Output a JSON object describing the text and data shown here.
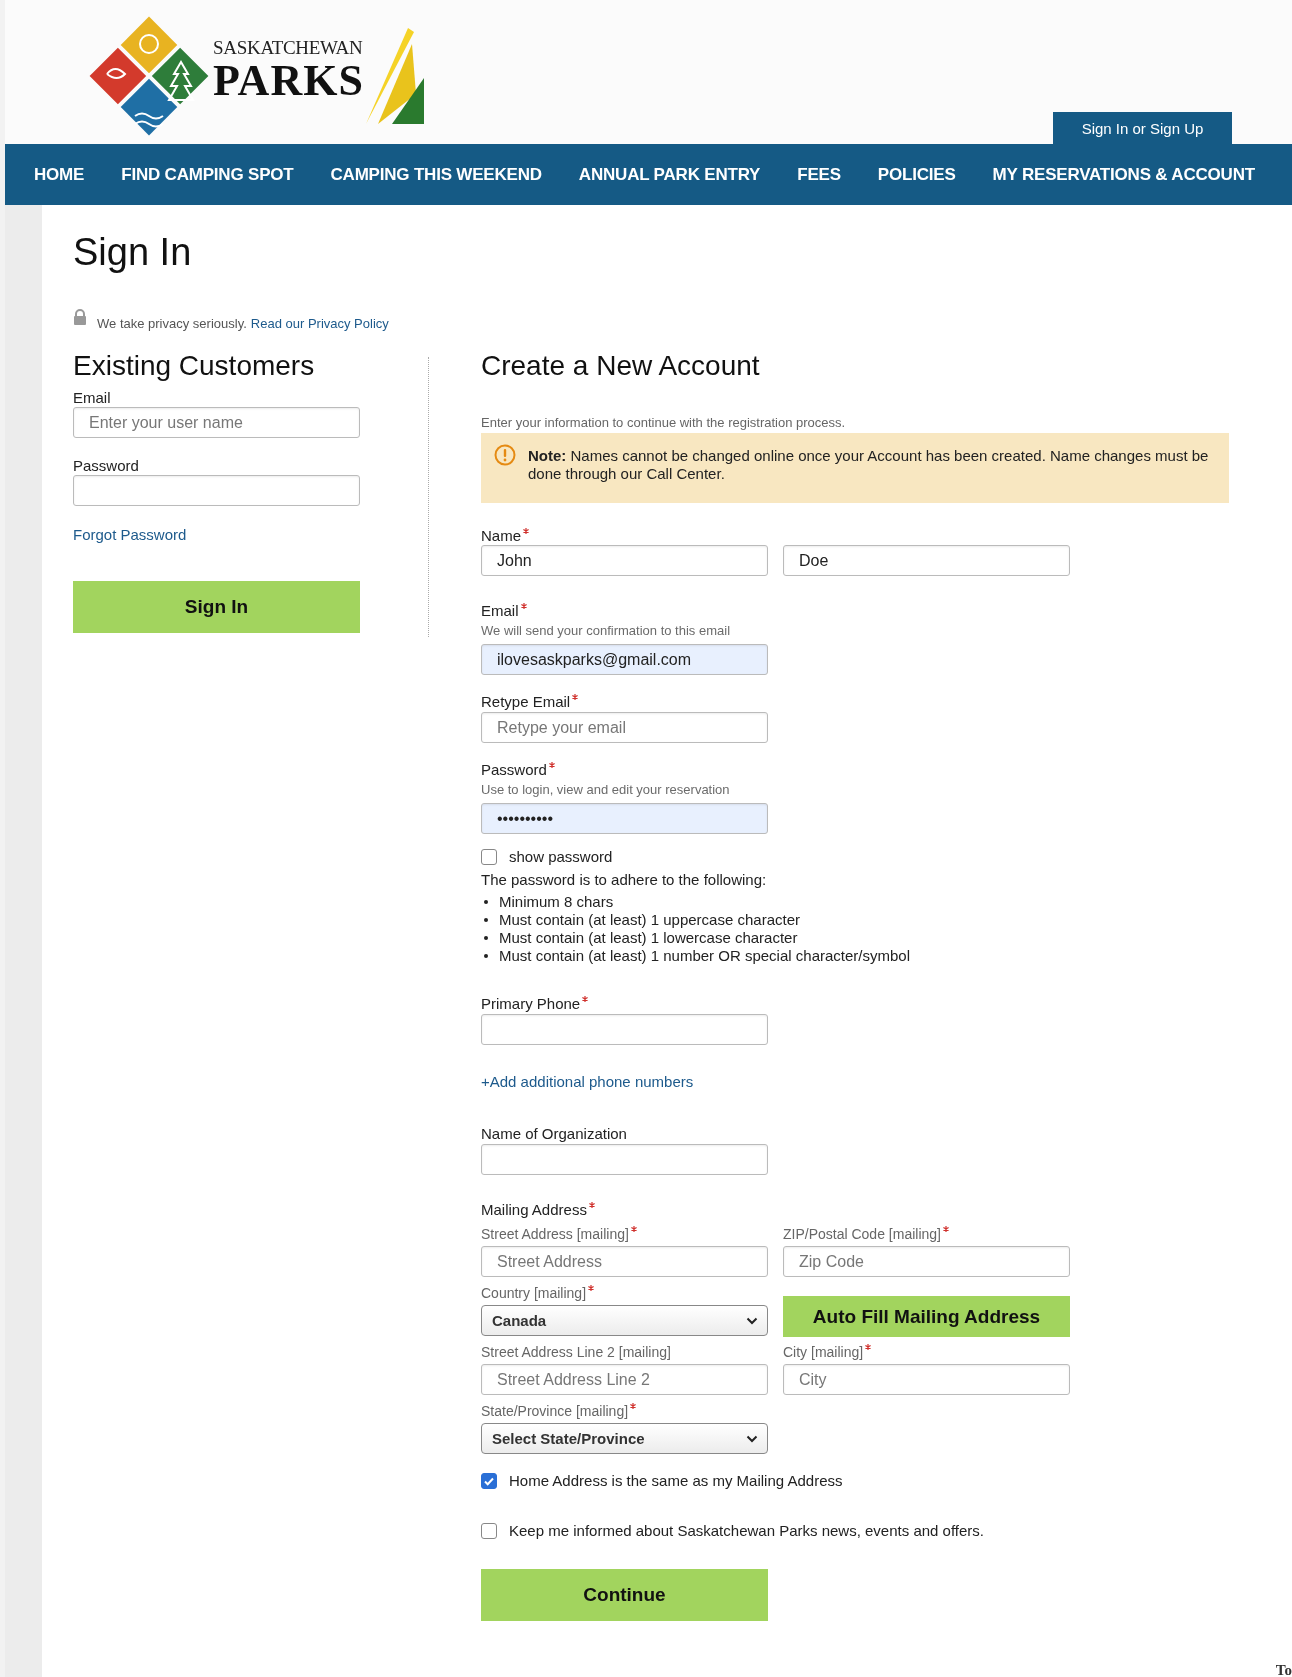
{
  "header": {
    "logo": {
      "line1": "SASKATCHEWAN",
      "line2": "PARKS"
    },
    "account_link": "Sign In or Sign Up"
  },
  "nav": [
    {
      "label": "HOME"
    },
    {
      "label": "FIND CAMPING SPOT"
    },
    {
      "label": "CAMPING THIS WEEKEND"
    },
    {
      "label": "ANNUAL PARK ENTRY"
    },
    {
      "label": "FEES"
    },
    {
      "label": "POLICIES"
    },
    {
      "label": "MY RESERVATIONS & ACCOUNT"
    }
  ],
  "page_title": "Sign In",
  "privacy": {
    "text": "We take privacy seriously.",
    "link": "Read our Privacy Policy"
  },
  "existing_customers": {
    "title": "Existing Customers",
    "fields": [
      {
        "label": "Email",
        "placeholder": "Enter your user name"
      },
      {
        "label": "Password"
      }
    ],
    "forgot_link": "Forgot Password",
    "button": "Sign In"
  },
  "new_account": {
    "title": "Create a New Account",
    "intro": "Enter your information to continue with the registration process.",
    "note": "**Note:** Names cannot be changed online once your Account has been created. Name changes must be done through our Call Center.",
    "fields": [
      {
        "kind": "name",
        "label": "Name",
        "required": true,
        "values": [
          "John",
          "Doe"
        ]
      },
      {
        "kind": "text",
        "label": "Email",
        "required": true,
        "hint": "We will send your confirmation to this email",
        "value": "ilovesaskparks@gmail.com",
        "autofilled": true
      },
      {
        "kind": "text",
        "label": "Retype Email",
        "required": true,
        "placeholder": "Retype your email",
        "autofilled": false
      },
      {
        "kind": "text",
        "label": "Password",
        "required": true,
        "hint": "Use to login, view and edit your reservation",
        "value": "••••••••••",
        "autofilled": true
      },
      {
        "kind": "checkbox",
        "label": "show password",
        "checked": false
      },
      {
        "kind": "rules",
        "title": "The password is to adhere to the following:",
        "items": [
          "Minimum 8 chars",
          "Must contain (at least) 1 uppercase character",
          "Must contain (at least) 1 lowercase character",
          "Must contain (at least) 1 number OR special character/symbol"
        ]
      },
      {
        "kind": "text",
        "label": "Primary Phone",
        "required": true,
        "autofilled": false
      },
      {
        "kind": "link",
        "label": "+Add additional phone numbers"
      },
      {
        "kind": "text",
        "label": "Name of Organization",
        "required": false,
        "autofilled": false
      }
    ],
    "mailing": {
      "label": "Mailing Address",
      "required": true,
      "fields": [
        {
          "kind": "text",
          "label": "Street Address [mailing]",
          "placeholder": "Street Address",
          "required": true
        },
        {
          "kind": "text",
          "label": "ZIP/Postal Code [mailing]",
          "placeholder": "Zip Code",
          "required": true
        },
        {
          "kind": "select",
          "label": "Country [mailing]",
          "value": "Canada",
          "required": true
        },
        {
          "kind": "button",
          "label": "Auto Fill Mailing Address"
        },
        {
          "kind": "text",
          "label": "Street Address Line 2 [mailing]",
          "placeholder": "Street Address Line 2",
          "required": false
        },
        {
          "kind": "text",
          "label": "City [mailing]",
          "placeholder": "City",
          "required": true
        },
        {
          "kind": "select",
          "label": "State/Province [mailing]",
          "value": "Select State/Province",
          "required": true
        }
      ]
    },
    "options": [
      {
        "label": "Home Address is the same as my Mailing Address",
        "checked": true
      },
      {
        "label": "Keep me informed about Saskatchewan Parks news, events and offers.",
        "checked": false
      }
    ],
    "continue_button": "Continue"
  },
  "corner_text": "To"
}
